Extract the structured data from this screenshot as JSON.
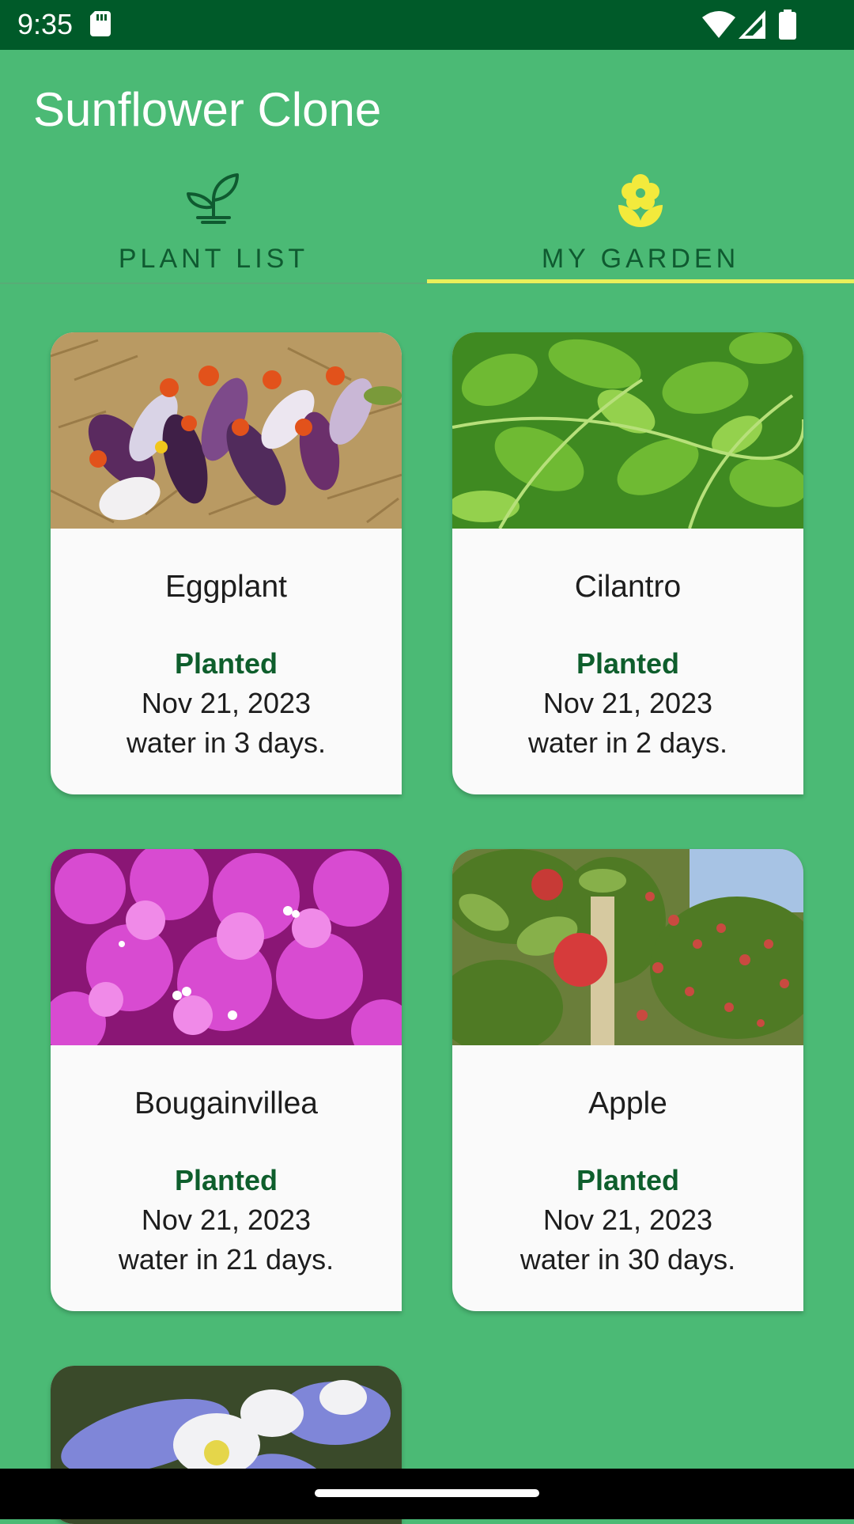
{
  "status": {
    "time": "9:35"
  },
  "app": {
    "title": "Sunflower Clone"
  },
  "tabs": [
    {
      "label": "PLANT LIST",
      "icon": "sprout-icon",
      "selected": false
    },
    {
      "label": "MY GARDEN",
      "icon": "flower-icon",
      "selected": true
    }
  ],
  "plants": [
    {
      "name": "Eggplant",
      "planted_label": "Planted",
      "date": "Nov 21, 2023",
      "water": "water in 3 days."
    },
    {
      "name": "Cilantro",
      "planted_label": "Planted",
      "date": "Nov 21, 2023",
      "water": "water in 2 days."
    },
    {
      "name": "Bougainvillea",
      "planted_label": "Planted",
      "date": "Nov 21, 2023",
      "water": "water in 21 days."
    },
    {
      "name": "Apple",
      "planted_label": "Planted",
      "date": "Nov 21, 2023",
      "water": "water in 30 days."
    }
  ],
  "colors": {
    "background": "#4bba75",
    "statusbar": "#005a29",
    "tab_text": "#0f5a30",
    "indicator": "#e9f05a",
    "accent_icon": "#f3ea3c",
    "planted_text": "#0e5e2c"
  }
}
